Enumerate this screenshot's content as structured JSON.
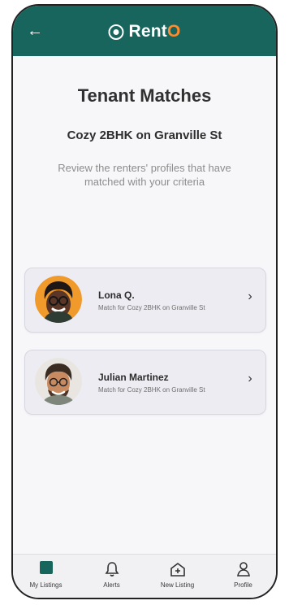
{
  "header": {
    "brand_prefix": "Rent",
    "brand_accent": "O",
    "back_icon": "arrow-left-icon",
    "logo_icon": "location-pin-icon"
  },
  "page": {
    "title": "Tenant Matches",
    "listing": "Cozy 2BHK on Granville St",
    "subtext": "Review the renters' profiles that have matched with your criteria"
  },
  "matches": [
    {
      "name": "Lona Q.",
      "detail": "Match for Cozy 2BHK on Granville St",
      "avatar_icon": "profile-photo-icon",
      "chevron_icon": "chevron-right-icon"
    },
    {
      "name": "Julian Martinez",
      "detail": "Match for Cozy 2BHK on Granville St",
      "avatar_icon": "profile-photo-icon",
      "chevron_icon": "chevron-right-icon"
    }
  ],
  "tabs": [
    {
      "label": "My Listings",
      "icon": "listings-icon",
      "active": true
    },
    {
      "label": "Alerts",
      "icon": "bell-icon",
      "active": false
    },
    {
      "label": "New Listing",
      "icon": "add-home-icon",
      "active": false
    },
    {
      "label": "Profile",
      "icon": "user-icon",
      "active": false
    }
  ],
  "colors": {
    "primary": "#17655c",
    "accent": "#ff8b2f",
    "card": "#ececf2",
    "background": "#f7f7fa"
  }
}
